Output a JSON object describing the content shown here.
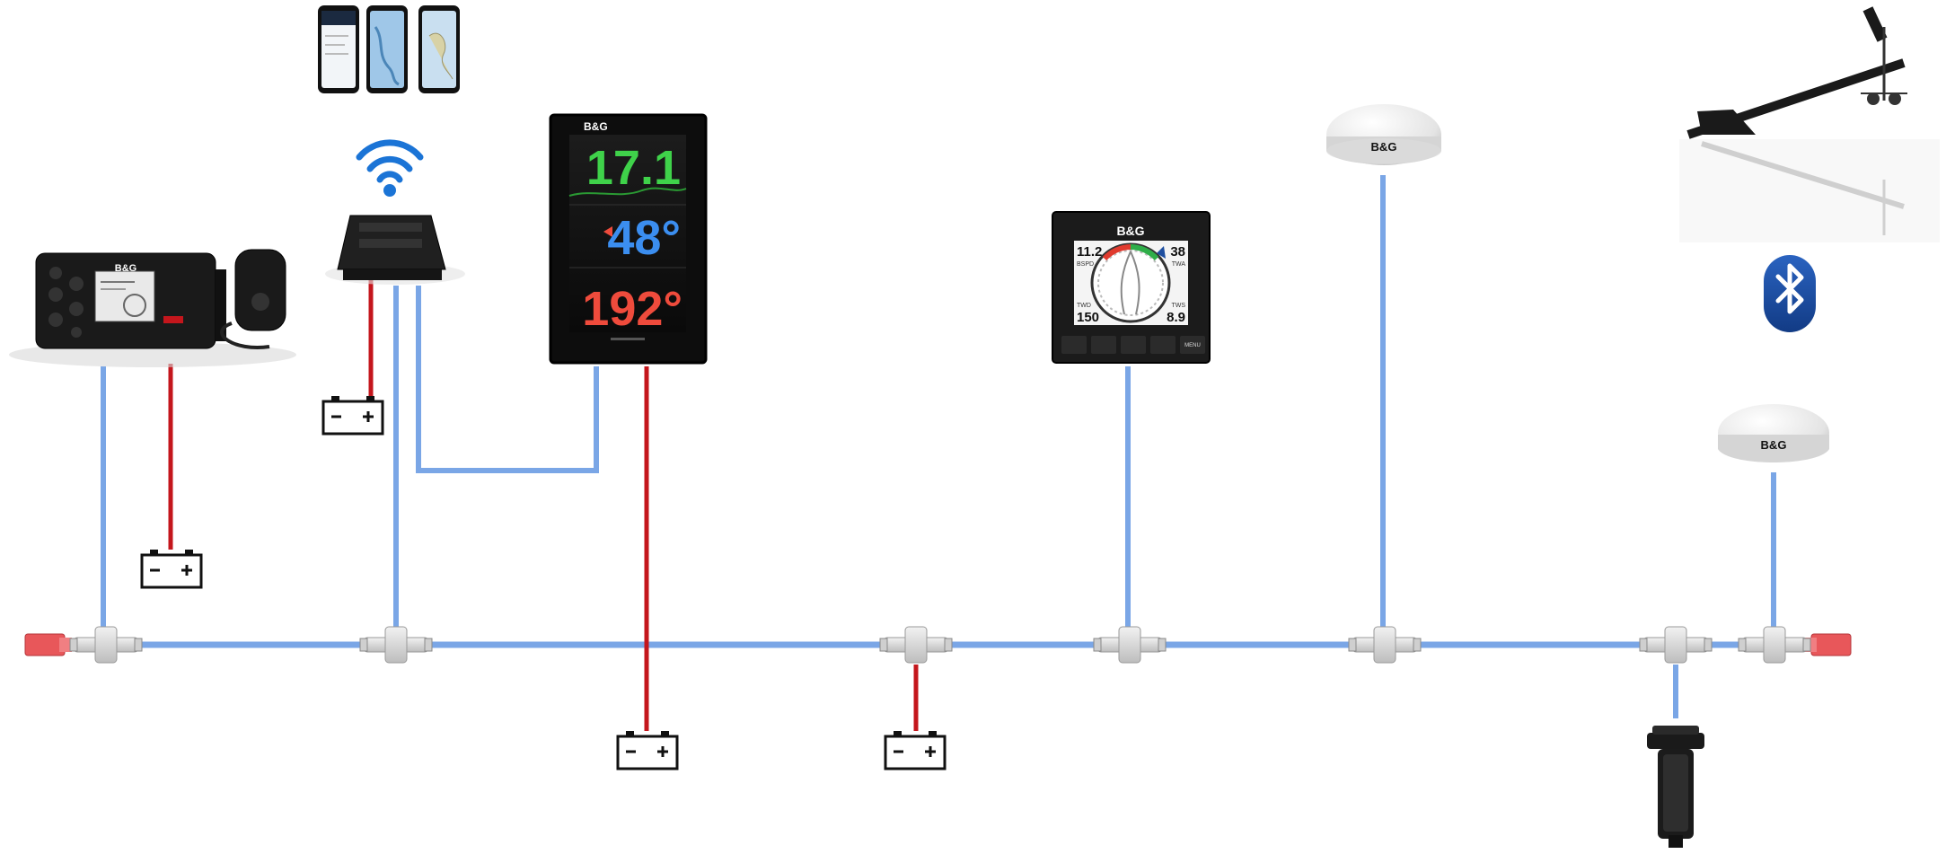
{
  "brand": "B&G",
  "display": {
    "value_1": "17.1",
    "value_2": "48°",
    "value_3": "192°"
  },
  "instrument": {
    "top_left_value": "11.2",
    "top_left_unit": "BSPD",
    "top_right_value": "38",
    "top_right_unit": "TWA",
    "bottom_left_value": "150",
    "bottom_left_unit": "TWD",
    "bottom_right_value": "8.9",
    "bottom_right_unit": "TWS",
    "menu_label": "MENU"
  },
  "colors": {
    "backbone": "#7aa6e6",
    "power": "#c4161c",
    "terminator": "#e8575a",
    "bluetooth": "#1f4fa0",
    "wifi": "#1b74d6",
    "display_green": "#3fd24a",
    "display_blue": "#3b8ef0",
    "display_red": "#ef4b3c"
  },
  "icons": [
    "wifi-icon",
    "bluetooth-icon",
    "battery-icon",
    "smartphone-icon"
  ]
}
